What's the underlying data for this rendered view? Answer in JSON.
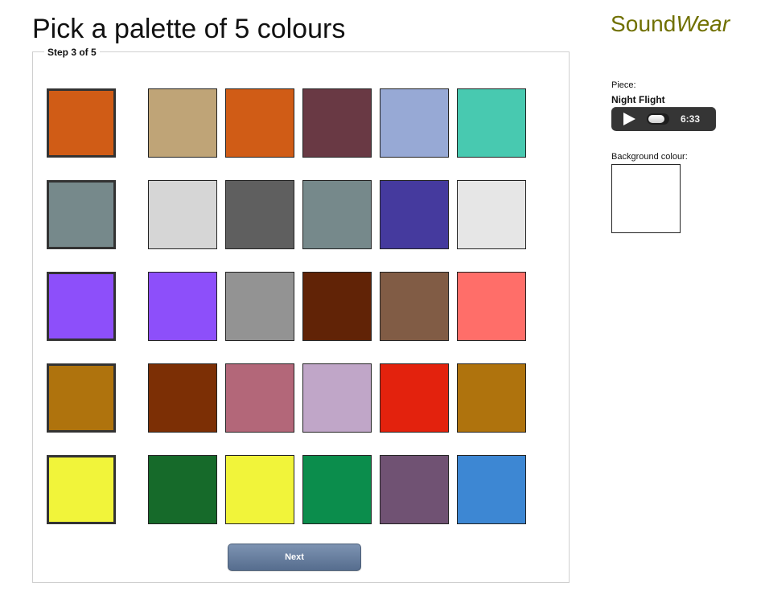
{
  "header": {
    "title": "Pick a palette of 5 colours",
    "logo_sound": "Sound",
    "logo_wear": "Wear"
  },
  "wizard": {
    "step_label": "Step 3 of 5",
    "next_label": "Next"
  },
  "palette": {
    "rows": [
      {
        "selected": "#d05c16",
        "options": [
          "#bfa477",
          "#d05c16",
          "#693944",
          "#97a9d5",
          "#48c9b0"
        ]
      },
      {
        "selected": "#76898b",
        "options": [
          "#d6d6d6",
          "#5f5f5f",
          "#76898b",
          "#453a9e",
          "#e6e6e6"
        ]
      },
      {
        "selected": "#8d4ffa",
        "options": [
          "#8d4ffa",
          "#939393",
          "#612306",
          "#815c45",
          "#ff6e69"
        ]
      },
      {
        "selected": "#af730d",
        "options": [
          "#7c2f05",
          "#b36779",
          "#c0a6c8",
          "#e3220d",
          "#af730d"
        ]
      },
      {
        "selected": "#f1f43a",
        "options": [
          "#166a2a",
          "#f1f43a",
          "#0b8d4c",
          "#705273",
          "#3d87d3"
        ]
      }
    ]
  },
  "sidebar": {
    "piece_label": "Piece:",
    "piece_name": "Night Flight",
    "player_time": "6:33",
    "background_label": "Background colour:",
    "background_color": "#ffffff"
  },
  "icons": {
    "play": "play-icon"
  },
  "colors": {
    "logo": "#707000",
    "button": "#6c82a1",
    "player": "#353535"
  }
}
